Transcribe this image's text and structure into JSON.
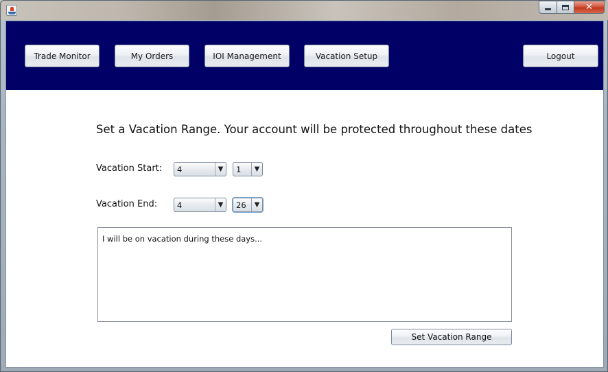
{
  "window": {
    "controls": {
      "minimize": "",
      "maximize": "",
      "close": "✕"
    }
  },
  "navbar": {
    "trade_monitor": "Trade Monitor",
    "my_orders": "My Orders",
    "ioi_management": "IOI Management",
    "vacation_setup": "Vacation Setup",
    "logout": "Logout"
  },
  "main": {
    "heading": "Set a Vacation Range. Your account will be protected throughout these dates",
    "start_label": "Vacation Start:",
    "start_month": "4",
    "start_day": "1",
    "end_label": "Vacation End:",
    "end_month": "4",
    "end_day": "26",
    "notes": "I will be on vacation during these days...",
    "set_button": "Set Vacation Range"
  },
  "icons": {
    "dropdown_arrow": "▼",
    "app_icon": "java-app-icon"
  }
}
